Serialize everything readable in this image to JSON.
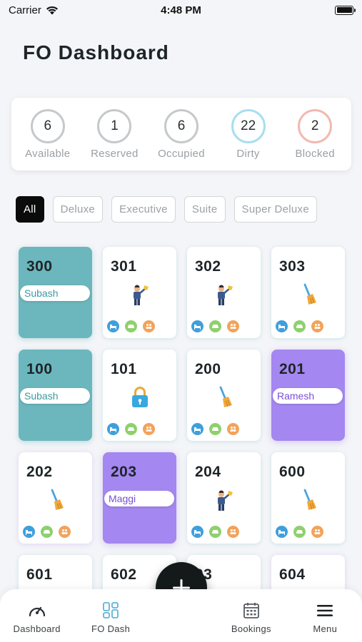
{
  "status_bar": {
    "carrier": "Carrier",
    "time": "4:48 PM"
  },
  "page_title": "FO Dashboard",
  "summary": [
    {
      "count": "6",
      "label": "Available",
      "ring_color": "#c6c9cb"
    },
    {
      "count": "1",
      "label": "Reserved",
      "ring_color": "#c6c9cb"
    },
    {
      "count": "6",
      "label": "Occupied",
      "ring_color": "#c6c9cb"
    },
    {
      "count": "22",
      "label": "Dirty",
      "ring_color": "#a8def0"
    },
    {
      "count": "2",
      "label": "Blocked",
      "ring_color": "#f3b8b0"
    }
  ],
  "filters": [
    {
      "label": "All",
      "active": true
    },
    {
      "label": "Deluxe",
      "active": false
    },
    {
      "label": "Executive",
      "active": false
    },
    {
      "label": "Suite",
      "active": false
    },
    {
      "label": "Super Deluxe",
      "active": false
    }
  ],
  "rooms": [
    {
      "number": "300",
      "state": "occupied",
      "guest": "Subash"
    },
    {
      "number": "301",
      "state": "cleaning"
    },
    {
      "number": "302",
      "state": "cleaning"
    },
    {
      "number": "303",
      "state": "dirty"
    },
    {
      "number": "100",
      "state": "occupied",
      "guest": "Subash"
    },
    {
      "number": "101",
      "state": "blocked"
    },
    {
      "number": "200",
      "state": "dirty"
    },
    {
      "number": "201",
      "state": "reserved",
      "guest": "Ramesh"
    },
    {
      "number": "202",
      "state": "dirty",
      "tint": "lavender"
    },
    {
      "number": "203",
      "state": "reserved",
      "guest": "Maggi"
    },
    {
      "number": "204",
      "state": "cleaning"
    },
    {
      "number": "600",
      "state": "dirty"
    },
    {
      "number": "601",
      "state": "partial"
    },
    {
      "number": "602",
      "state": "partial"
    },
    {
      "number": "603",
      "state": "partial",
      "display": "03"
    },
    {
      "number": "604",
      "state": "partial",
      "tint": "lavender"
    }
  ],
  "nav": {
    "dashboard": "Dashboard",
    "fo_dash": "FO Dash",
    "bookings": "Bookings",
    "menu": "Menu"
  },
  "colors": {
    "occupied": "#6bb7bd",
    "reserved": "#a487f0",
    "active_chip": "#0b0b0b",
    "fo_dash_icon": "#5bb6d9"
  }
}
